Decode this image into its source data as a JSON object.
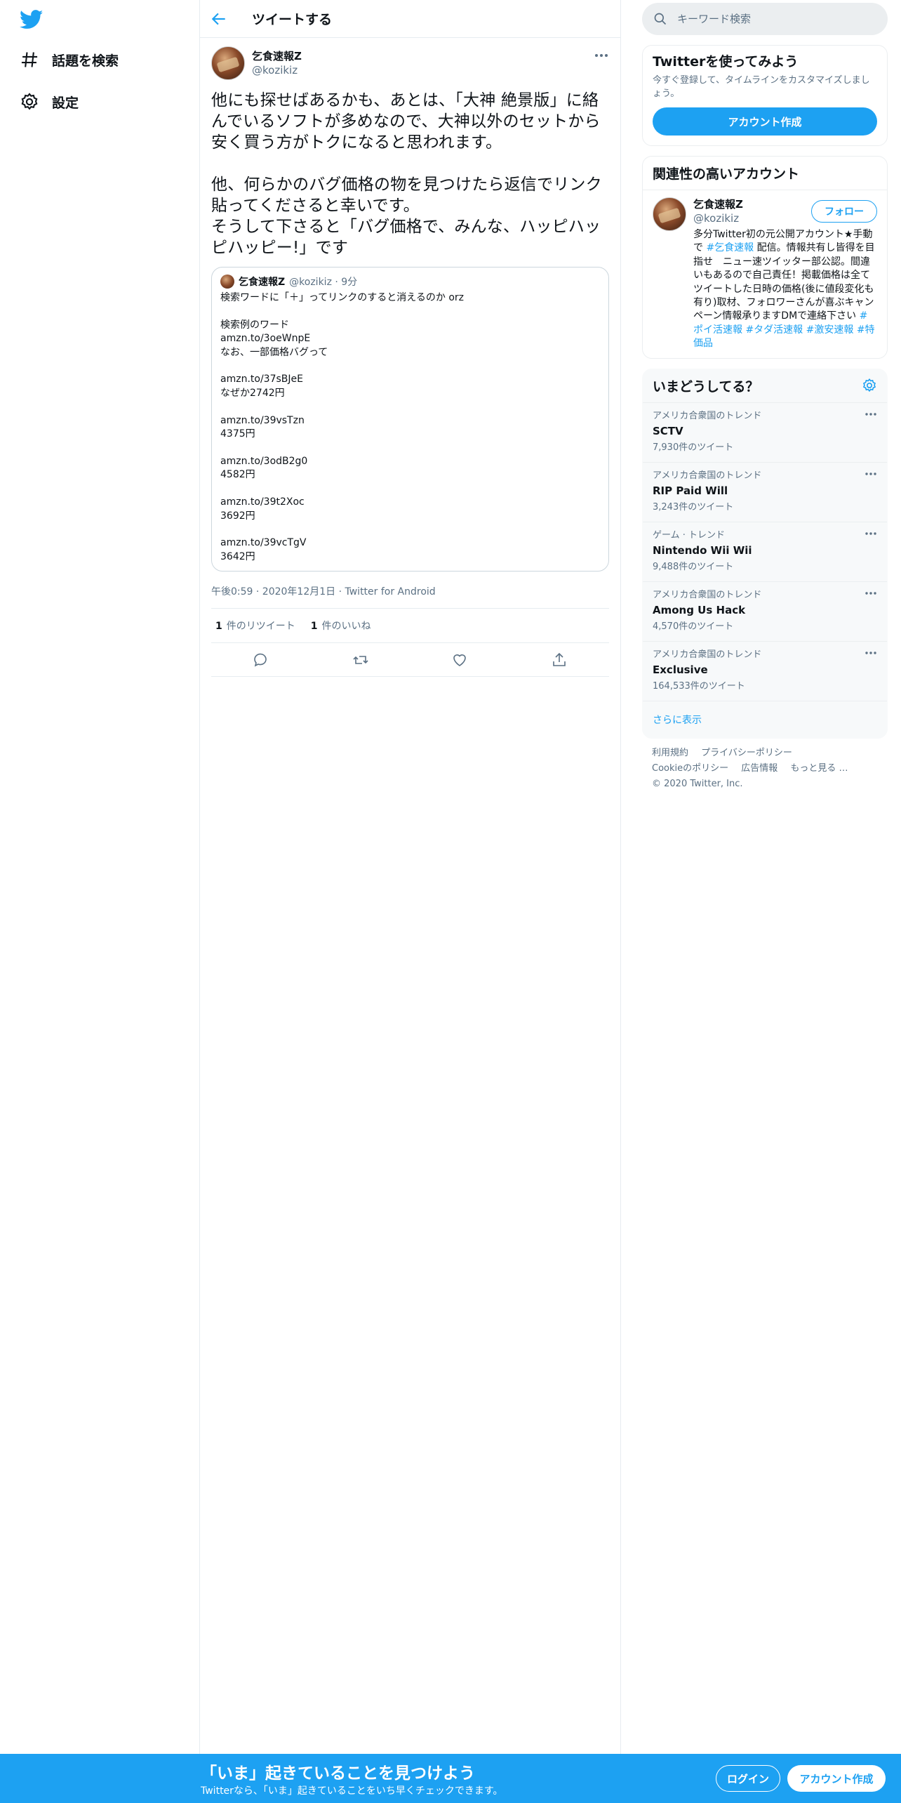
{
  "colors": {
    "accent": "#1da1f2",
    "text": "#0f1419",
    "muted": "#5b7083",
    "border": "#e6ecf0"
  },
  "nav": {
    "items": [
      {
        "label": "話題を検索",
        "icon": "hash-icon"
      },
      {
        "label": "設定",
        "icon": "gear-icon"
      }
    ]
  },
  "header": {
    "title": "ツイートする"
  },
  "tweet": {
    "name": "乞食速報Z",
    "handle": "@kozikiz",
    "text": "他にも探せばあるかも、あとは、「大神 絶景版」に絡んでいるソフトが多めなので、大神以外のセットから安く買う方がトクになると思われます。\n\n他、何らかのバグ価格の物を見つけたら返信でリンク貼ってくださると幸いです。\nそうして下さると「バグ価格で、みんな、ハッピハッピハッピー!」です",
    "quote": {
      "name": "乞食速報Z",
      "meta": "@kozikiz · 9分",
      "text": "検索ワードに「＋」ってリンクのすると消えるのか orz\n\n検索例のワード\namzn.to/3oeWnpE\nなお、一部価格バグって\n\namzn.to/37sBJeE\nなぜか2742円\n\namzn.to/39vsTzn\n4375円\n\namzn.to/3odB2g0\n4582円\n\namzn.to/39t2Xoc\n3692円\n\namzn.to/39vcTgV\n3642円"
    },
    "timestamp": "午後0:59 · 2020年12月1日 · Twitter for Android",
    "retweets": "1",
    "retweets_label": "件のリツイート",
    "likes": "1",
    "likes_label": "件のいいね"
  },
  "sidebar": {
    "search_placeholder": "キーワード検索",
    "signup": {
      "title": "Twitterを使ってみよう",
      "desc": "今すぐ登録して、タイムラインをカスタマイズしましょう。",
      "button": "アカウント作成"
    },
    "relevant": {
      "title": "関連性の高いアカウント",
      "name": "乞食速報Z",
      "handle": "@kozikiz",
      "follow": "フォロー",
      "bio_a": "多分Twitter初の元公開アカウント★手動で ",
      "bio_tag1": "#乞食速報",
      "bio_b": " 配信。情報共有し皆得を目指せ　ニュー速ツイッター部公認。間違いもあるので自己責任！掲載価格は全てツイートした日時の価格(後に値段変化も有り)取材、フォロワーさんが喜ぶキャンペーン情報承りますDMで連絡下さい ",
      "bio_tag2": "#ポイ活速報",
      "bio_tag3": "#タダ活速報",
      "bio_tag4": "#激安速報",
      "bio_tag5": "#特価品"
    },
    "trends": {
      "title": "いまどうしてる？",
      "items": [
        {
          "context": "アメリカ合衆国のトレンド",
          "name": "SCTV",
          "count": "7,930件のツイート"
        },
        {
          "context": "アメリカ合衆国のトレンド",
          "name": "RIP Paid Will",
          "count": "3,243件のツイート"
        },
        {
          "context": "ゲーム · トレンド",
          "name": "Nintendo Wii Wii",
          "count": "9,488件のツイート"
        },
        {
          "context": "アメリカ合衆国のトレンド",
          "name": "Among Us Hack",
          "count": "4,570件のツイート"
        },
        {
          "context": "アメリカ合衆国のトレンド",
          "name": "Exclusive",
          "count": "164,533件のツイート"
        }
      ],
      "show_more": "さらに表示"
    },
    "footer": {
      "links": [
        "利用規約",
        "プライバシーポリシー",
        "Cookieのポリシー",
        "広告情報",
        "もっと見る …",
        "© 2020 Twitter, Inc."
      ]
    }
  },
  "bottom": {
    "title": "「いま」起きていることを見つけよう",
    "subtitle": "Twitterなら、「いま」起きていることをいち早くチェックできます。",
    "login": "ログイン",
    "signup": "アカウント作成"
  }
}
